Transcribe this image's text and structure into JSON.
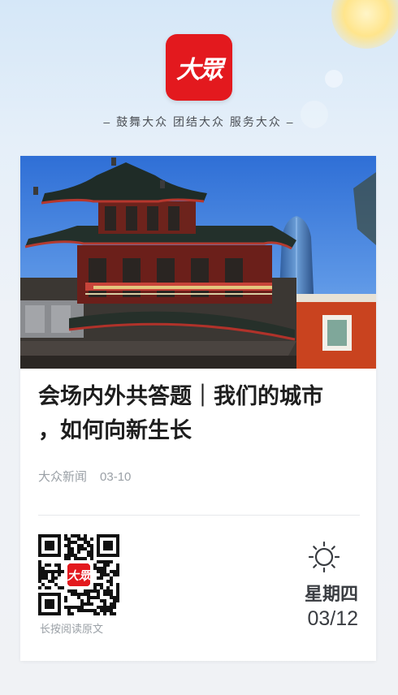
{
  "header": {
    "logo_text": "大眾",
    "slogan": "– 鼓舞大众 团结大众 服务大众 –"
  },
  "article": {
    "headline_line1": "会场内外共答题｜我们的城市",
    "headline_line2": "，如何向新生长",
    "source": "大众新闻",
    "date": "03-10"
  },
  "footer": {
    "qr_logo_text": "大眾",
    "qr_caption": "长按阅读原文",
    "weather_icon": "sun-icon",
    "weekday": "星期四",
    "date": "03/12"
  },
  "colors": {
    "brand_red": "#e3191e",
    "text_dark": "#1e1e1e",
    "text_muted": "#9aa0a6"
  }
}
